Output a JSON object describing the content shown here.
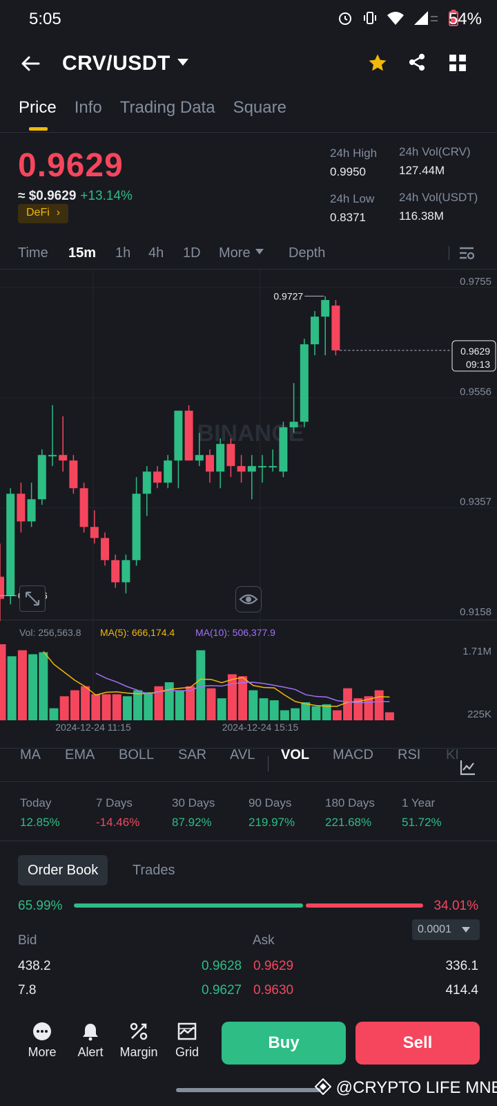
{
  "status_bar": {
    "time": "5:05",
    "battery": "54%"
  },
  "header": {
    "pair": "CRV/USDT"
  },
  "tabs": [
    "Price",
    "Info",
    "Trading Data",
    "Square"
  ],
  "price": {
    "last": "0.9629",
    "usd_prefix": "≈ $0.9629",
    "change": "+13.14%",
    "sector": "DeFi",
    "high_label": "24h High",
    "high": "0.9950",
    "low_label": "24h Low",
    "low": "0.8371",
    "vol_base_label": "24h Vol(CRV)",
    "vol_base": "127.44M",
    "vol_quote_label": "24h Vol(USDT)",
    "vol_quote": "116.38M"
  },
  "intervals": [
    "Time",
    "15m",
    "1h",
    "4h",
    "1D",
    "More",
    "Depth"
  ],
  "chart_data": {
    "type": "candlestick",
    "watermark": "BINANCE",
    "price_axis": [
      "0.9755",
      "0.9556",
      "0.9357",
      "0.9158"
    ],
    "ylim": [
      0.9158,
      0.9755
    ],
    "high_marker": "0.9727",
    "low_marker": "0.9186",
    "last_price": "0.9629",
    "countdown": "09:13",
    "candles": [
      {
        "o": 0.922,
        "h": 0.928,
        "l": 0.914,
        "c": 0.918
      },
      {
        "o": 0.9185,
        "h": 0.938,
        "l": 0.917,
        "c": 0.937
      },
      {
        "o": 0.937,
        "h": 0.939,
        "l": 0.93,
        "c": 0.932
      },
      {
        "o": 0.932,
        "h": 0.939,
        "l": 0.931,
        "c": 0.936
      },
      {
        "o": 0.936,
        "h": 0.945,
        "l": 0.935,
        "c": 0.944
      },
      {
        "o": 0.944,
        "h": 0.953,
        "l": 0.942,
        "c": 0.944
      },
      {
        "o": 0.944,
        "h": 0.951,
        "l": 0.941,
        "c": 0.943
      },
      {
        "o": 0.943,
        "h": 0.944,
        "l": 0.937,
        "c": 0.938
      },
      {
        "o": 0.938,
        "h": 0.939,
        "l": 0.93,
        "c": 0.931
      },
      {
        "o": 0.931,
        "h": 0.934,
        "l": 0.928,
        "c": 0.929
      },
      {
        "o": 0.929,
        "h": 0.93,
        "l": 0.924,
        "c": 0.925
      },
      {
        "o": 0.925,
        "h": 0.926,
        "l": 0.92,
        "c": 0.921
      },
      {
        "o": 0.921,
        "h": 0.926,
        "l": 0.919,
        "c": 0.925
      },
      {
        "o": 0.925,
        "h": 0.94,
        "l": 0.924,
        "c": 0.937
      },
      {
        "o": 0.937,
        "h": 0.942,
        "l": 0.933,
        "c": 0.941
      },
      {
        "o": 0.941,
        "h": 0.942,
        "l": 0.938,
        "c": 0.939
      },
      {
        "o": 0.939,
        "h": 0.944,
        "l": 0.938,
        "c": 0.943
      },
      {
        "o": 0.943,
        "h": 0.951,
        "l": 0.938,
        "c": 0.952
      },
      {
        "o": 0.952,
        "h": 0.953,
        "l": 0.943,
        "c": 0.943
      },
      {
        "o": 0.943,
        "h": 0.948,
        "l": 0.942,
        "c": 0.944
      },
      {
        "o": 0.944,
        "h": 0.945,
        "l": 0.939,
        "c": 0.941
      },
      {
        "o": 0.941,
        "h": 0.947,
        "l": 0.938,
        "c": 0.946
      },
      {
        "o": 0.946,
        "h": 0.947,
        "l": 0.94,
        "c": 0.942
      },
      {
        "o": 0.942,
        "h": 0.944,
        "l": 0.939,
        "c": 0.941
      },
      {
        "o": 0.941,
        "h": 0.944,
        "l": 0.936,
        "c": 0.942
      },
      {
        "o": 0.942,
        "h": 0.944,
        "l": 0.939,
        "c": 0.942
      },
      {
        "o": 0.942,
        "h": 0.945,
        "l": 0.941,
        "c": 0.942
      },
      {
        "o": 0.941,
        "h": 0.95,
        "l": 0.94,
        "c": 0.949
      },
      {
        "o": 0.949,
        "h": 0.957,
        "l": 0.948,
        "c": 0.95
      },
      {
        "o": 0.95,
        "h": 0.965,
        "l": 0.949,
        "c": 0.964
      },
      {
        "o": 0.964,
        "h": 0.97,
        "l": 0.962,
        "c": 0.969
      },
      {
        "o": 0.969,
        "h": 0.9727,
        "l": 0.962,
        "c": 0.972
      },
      {
        "o": 0.971,
        "h": 0.972,
        "l": 0.962,
        "c": 0.9629
      }
    ],
    "volume": {
      "label": "Vol: 256,563.8",
      "ma5_label": "MA(5): 666,174.4",
      "ma10_label": "MA(10): 506,377.9",
      "axis": [
        "1.71M",
        "225K"
      ],
      "ylim": [
        0,
        1.71
      ],
      "values": [
        1.9,
        1.6,
        1.75,
        1.65,
        1.7,
        0.3,
        0.6,
        0.75,
        0.85,
        0.65,
        0.65,
        0.65,
        0.6,
        0.75,
        0.7,
        0.85,
        0.95,
        0.75,
        0.85,
        1.75,
        0.8,
        0.55,
        1.15,
        1.1,
        0.75,
        0.55,
        0.5,
        0.25,
        0.3,
        0.45,
        0.35,
        0.4,
        0.25,
        0.8,
        0.55,
        0.6,
        0.75,
        0.2
      ],
      "dates": [
        "2024-12-24 11:15",
        "2024-12-24 15:15"
      ]
    }
  },
  "indicators": [
    "MA",
    "EMA",
    "BOLL",
    "SAR",
    "AVL",
    "VOL",
    "MACD",
    "RSI",
    "KI"
  ],
  "performance": [
    {
      "label": "Today",
      "value": "12.85%",
      "color": "#2ebd85"
    },
    {
      "label": "7 Days",
      "value": "-14.46%",
      "color": "#f6465d"
    },
    {
      "label": "30 Days",
      "value": "87.92%",
      "color": "#2ebd85"
    },
    {
      "label": "90 Days",
      "value": "219.97%",
      "color": "#2ebd85"
    },
    {
      "label": "180 Days",
      "value": "221.68%",
      "color": "#2ebd85"
    },
    {
      "label": "1 Year",
      "value": "51.72%",
      "color": "#2ebd85"
    }
  ],
  "order_book": {
    "tabs": [
      "Order Book",
      "Trades"
    ],
    "bid_pct": "65.99%",
    "ask_pct": "34.01%",
    "bid_label": "Bid",
    "ask_label": "Ask",
    "precision": "0.0001",
    "rows": [
      {
        "bid_qty": "438.2",
        "bid_price": "0.9628",
        "ask_price": "0.9629",
        "ask_qty": "336.1"
      },
      {
        "bid_qty": "7.8",
        "bid_price": "0.9627",
        "ask_price": "0.9630",
        "ask_qty": "414.4"
      }
    ]
  },
  "bottom_bar": {
    "items": [
      "More",
      "Alert",
      "Margin",
      "Grid"
    ],
    "buy": "Buy",
    "sell": "Sell"
  },
  "watermark_text": "@CRYPTO LIFE MNE",
  "colors": {
    "up": "#2ebd85",
    "down": "#f6465d",
    "accent": "#f0b90b",
    "bg": "#181a20"
  }
}
